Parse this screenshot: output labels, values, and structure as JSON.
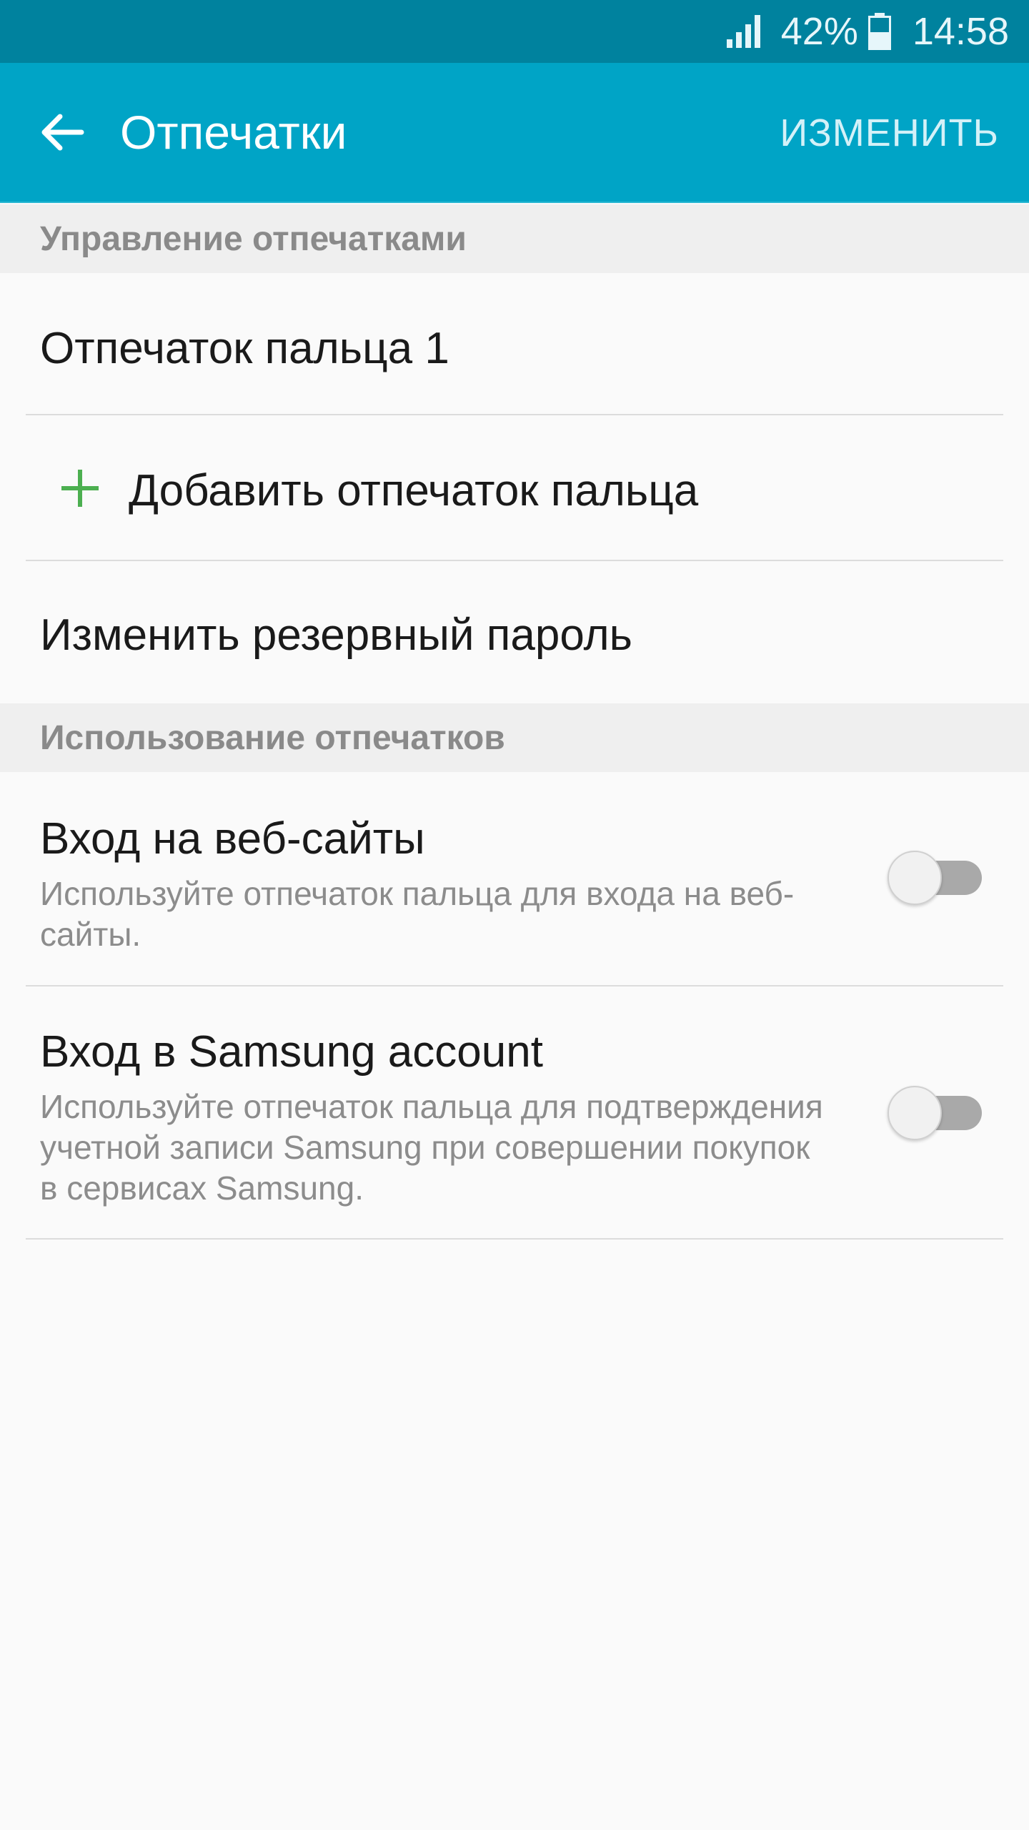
{
  "status_bar": {
    "battery_percent": "42%",
    "time": "14:58",
    "icons": [
      "signal-icon",
      "battery-icon"
    ]
  },
  "app_bar": {
    "back_icon": "arrow-left-icon",
    "title": "Отпечатки",
    "edit_label": "ИЗМЕНИТЬ"
  },
  "sections": {
    "manage": {
      "header": "Управление отпечатками",
      "fingerprint_1": "Отпечаток пальца 1",
      "add_fingerprint": "Добавить отпечаток пальца",
      "change_backup_password": "Изменить резервный пароль"
    },
    "usage": {
      "header": "Использование отпечатков",
      "web_signin": {
        "title": "Вход на веб-сайты",
        "line1": "Используйте отпечаток пальца для входа на веб-",
        "line2": "сайты.",
        "enabled": false
      },
      "samsung_account": {
        "title": "Вход в Samsung account",
        "line1": "Используйте отпечаток пальца для подтверждения",
        "line2": "учетной записи Samsung при совершении покупок",
        "line3": "в сервисах Samsung.",
        "enabled": false
      }
    }
  },
  "colors": {
    "status_bar": "#00829e",
    "app_bar": "#00a4c6",
    "plus_icon": "#4caf50",
    "toggle_track": "#a9a9a9"
  }
}
